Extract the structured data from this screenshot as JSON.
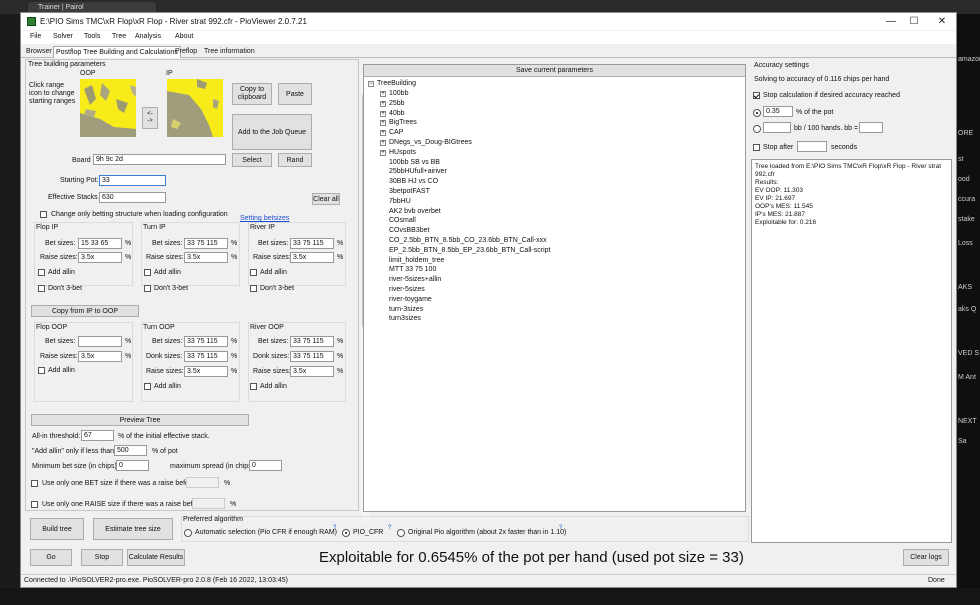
{
  "browser": {
    "tab_label": "Trainer | Pairol"
  },
  "right_strip": [
    "amazon",
    "ORE",
    "st",
    "ood",
    "ccura",
    "stake",
    "Loss",
    "AKS",
    "aks Q",
    "VED S",
    "M Ant",
    "NEXT",
    "Sa"
  ],
  "window": {
    "title": "E:\\PIO Sims TMC\\xR Flop\\xR Flop - River strat 992.cfr - PioViewer 2.0.7.21",
    "minimize": "—",
    "maximize": "☐",
    "close": "✕"
  },
  "menu": [
    "File",
    "Solver",
    "Tools",
    "Tree",
    "Analysis",
    "About"
  ],
  "tabs": [
    "Browser",
    "Postflop Tree Building and Calculations",
    "Preflop",
    "Tree information"
  ],
  "params": {
    "group_title": "Tree building parameters",
    "oop_label": "OOP",
    "ip_label": "IP",
    "range_hint": "Click range icon to change starting ranges",
    "swap_label": "<-\n->",
    "copy_label": "Copy to clipboard",
    "paste_label": "Paste",
    "add_job_label": "Add to the Job Queue",
    "board_label": "Board",
    "board_value": "9h 9c 2d",
    "select_label": "Select",
    "rand_label": "Rand",
    "starting_pot_label": "Starting Pot:",
    "starting_pot_value": "33",
    "eff_stacks_label": "Effective Stacks",
    "eff_stacks_value": "630",
    "clear_all_label": "Clear all",
    "change_only_label": "Change only betting structure when loading configuration",
    "setting_betsizes_link": "Setting betsizes",
    "flop_ip": {
      "title": "Flop IP",
      "bet_label": "Bet sizes:",
      "bet_value": "15 33 65",
      "raise_label": "Raise sizes:",
      "raise_value": "3.5x",
      "add_allin": "Add allin",
      "dont_3bet": "Don't 3-bet"
    },
    "turn_ip": {
      "title": "Turn IP",
      "bet_label": "Bet sizes:",
      "bet_value": "33 75 115",
      "raise_label": "Raise sizes:",
      "raise_value": "3.5x",
      "add_allin": "Add allin",
      "dont_3bet": "Don't 3-bet"
    },
    "river_ip": {
      "title": "River IP",
      "bet_label": "Bet sizes:",
      "bet_value": "33 75 115",
      "raise_label": "Raise sizes:",
      "raise_value": "3.5x",
      "add_allin": "Add allin",
      "dont_3bet": "Don't 3-bet"
    },
    "copy_ip_oop": "Copy from IP to OOP",
    "flop_oop": {
      "title": "Flop OOP",
      "bet_label": "Bet sizes:",
      "bet_value": "",
      "raise_label": "Raise sizes:",
      "raise_value": "3.5x",
      "add_allin": "Add allin"
    },
    "turn_oop": {
      "title": "Turn OOP",
      "bet_label": "Bet sizes:",
      "bet_value": "33 75 115",
      "donk_label": "Donk sizes:",
      "donk_value": "33 75 115",
      "raise_label": "Raise sizes:",
      "raise_value": "3.5x",
      "add_allin": "Add allin"
    },
    "river_oop": {
      "title": "River OOP",
      "bet_label": "Bet sizes:",
      "bet_value": "33 75 115",
      "donk_label": "Donk sizes:",
      "donk_value": "33 75 115",
      "raise_label": "Raise sizes:",
      "raise_value": "3.5x",
      "add_allin": "Add allin"
    },
    "pct": "%",
    "preview_tree": "Preview Tree",
    "allin_threshold_label": "All-in threshold:",
    "allin_threshold_value": "67",
    "allin_threshold_suffix": "% of the initial effective stack.",
    "add_allin_if_label": "\"Add allin\" only if less than",
    "add_allin_if_value": "500",
    "add_allin_if_suffix": "% of pot",
    "min_bet_label": "Minimum bet size (in chips):",
    "min_bet_value": "0",
    "max_spread_label": "maximum spread (in chips):",
    "max_spread_value": "0",
    "one_bet_label": "Use only one BET size if there was a raise before",
    "one_raise_label": "Use only one RAISE size if there was a raise before"
  },
  "tree": {
    "save_label": "Save current parameters",
    "root": "TreeBuilding",
    "folders": [
      "100bb",
      "25bb",
      "40bb",
      "BigTrees",
      "CAP",
      "DNegs_vs_Doug-BIGtrees",
      "HUspots"
    ],
    "files": [
      "100bb SB vs BB",
      "25bbHUfull+airiver",
      "30BB HJ vs CO",
      "3betpotFAST",
      "7bbHU",
      "AK2 bvb overbet",
      "COsmall",
      "COvsBB3bet",
      "CO_2.5bb_BTN_8.5bb_CO_23.6bb_BTN_Call-xxx",
      "EP_2.5bb_BTN_8.5bb_EP_23.6bb_BTN_Call-script",
      "limit_holdem_tree",
      "MTT 33 75 100",
      "river-5sizes+allin",
      "river-5sizes",
      "river-toygame",
      "turn-3sizes",
      "turn3sizes"
    ]
  },
  "accuracy": {
    "title": "Accuracy settings",
    "solving_text": "Solving to accuracy of 0.116 chips per hand",
    "stop_label": "Stop calculation if desired accuracy reached",
    "pct_value": "0.35",
    "pct_label": "% of the pot",
    "bb_label": "bb / 100 hands. bb =",
    "stop_after_label": "Stop after",
    "seconds_label": "seconds"
  },
  "log": [
    "Tree loaded from E:\\PIO Sims TMC\\xR Flop\\xR Flop - River strat",
    "992.cfr",
    "Results:",
    "EV OOP: 11.303",
    "EV IP: 21.697",
    "OOP's MES: 11.545",
    "IP's MES: 21.887",
    "Exploitable for: 0.216"
  ],
  "bottom": {
    "build_tree": "Build tree",
    "estimate_tree": "Estimate tree size",
    "pref_title": "Preferred algorithm",
    "auto_label": "Automatic selection (Pio CFR if enough RAM)",
    "pio_cfr_label": "PIO_CFR",
    "original_label": "Original Pio algorithm (about 2x faster than in 1.10)",
    "help": "?",
    "go": "Go",
    "stop": "Stop",
    "calc_results": "Calculate Results",
    "clear_logs": "Clear logs"
  },
  "exploit_text": "Exploitable for 0.6545% of the pot per hand (used pot size = 33)",
  "status": {
    "left": "Connected to .\\PioSOLVER2-pro.exe. PioSOLVER-pro 2.0.8 (Feb 16 2022, 13:03:45)",
    "right": "Done"
  }
}
